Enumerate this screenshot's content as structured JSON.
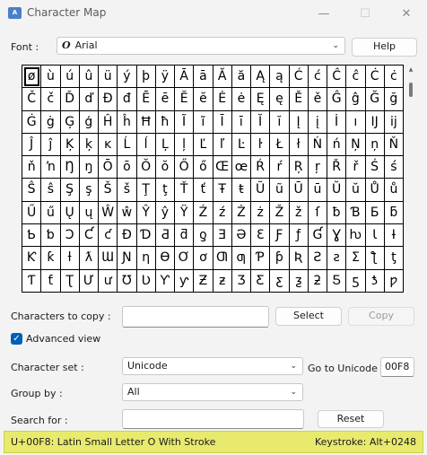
{
  "window": {
    "title": "Character Map",
    "icon_name": "character-map-app-icon",
    "controls": {
      "minimize": "—",
      "maximize": "☐",
      "close": "✕"
    }
  },
  "font": {
    "label": "Font :",
    "value": "Arial",
    "help_label": "Help"
  },
  "characters": [
    "ø",
    "ù",
    "ú",
    "û",
    "ü",
    "ý",
    "þ",
    "ÿ",
    "Ā",
    "ā",
    "Ă",
    "ă",
    "Ą",
    "ą",
    "Ć",
    "ć",
    "Ĉ",
    "ĉ",
    "Ċ",
    "ċ",
    "Č",
    "č",
    "Ď",
    "ď",
    "Đ",
    "đ",
    "Ē",
    "ē",
    "Ĕ",
    "ĕ",
    "Ė",
    "ė",
    "Ę",
    "ę",
    "Ě",
    "ě",
    "Ĝ",
    "ĝ",
    "Ğ",
    "ğ",
    "Ġ",
    "ġ",
    "Ģ",
    "ģ",
    "Ĥ",
    "ĥ",
    "Ħ",
    "ħ",
    "Ĩ",
    "ĩ",
    "Ī",
    "ī",
    "Ĭ",
    "ĭ",
    "Į",
    "į",
    "İ",
    "ı",
    "Ĳ",
    "ĳ",
    "Ĵ",
    "ĵ",
    "Ķ",
    "ķ",
    "ĸ",
    "Ĺ",
    "ĺ",
    "Ļ",
    "ļ",
    "Ľ",
    "ľ",
    "Ŀ",
    "ŀ",
    "Ł",
    "ł",
    "Ń",
    "ń",
    "Ņ",
    "ņ",
    "Ň",
    "ň",
    "ŉ",
    "Ŋ",
    "ŋ",
    "Ō",
    "ō",
    "Ŏ",
    "ŏ",
    "Ő",
    "ő",
    "Œ",
    "œ",
    "Ŕ",
    "ŕ",
    "Ŗ",
    "ŗ",
    "Ř",
    "ř",
    "Ś",
    "ś",
    "Ŝ",
    "ŝ",
    "Ş",
    "ş",
    "Š",
    "š",
    "Ţ",
    "ţ",
    "Ť",
    "ť",
    "Ŧ",
    "ŧ",
    "Ũ",
    "ũ",
    "Ū",
    "ū",
    "Ŭ",
    "ŭ",
    "Ů",
    "ů",
    "Ű",
    "ű",
    "Ų",
    "ų",
    "Ŵ",
    "ŵ",
    "Ŷ",
    "ŷ",
    "Ÿ",
    "Ź",
    "ź",
    "Ż",
    "ż",
    "Ž",
    "ž",
    "ſ",
    "ƀ",
    "Ɓ",
    "Ƃ",
    "ƃ",
    "Ƅ",
    "ƅ",
    "Ɔ",
    "Ƈ",
    "ƈ",
    "Ɖ",
    "Ɗ",
    "Ƌ",
    "ƌ",
    "ƍ",
    "Ǝ",
    "Ə",
    "Ɛ",
    "Ƒ",
    "ƒ",
    "Ɠ",
    "Ɣ",
    "ƕ",
    "Ɩ",
    "Ɨ",
    "Ƙ",
    "ƙ",
    "ƚ",
    "ƛ",
    "Ɯ",
    "Ɲ",
    "ƞ",
    "Ɵ",
    "Ơ",
    "ơ",
    "Ƣ",
    "ƣ",
    "Ƥ",
    "ƥ",
    "Ʀ",
    "Ƨ",
    "ƨ",
    "Ʃ",
    "ƪ",
    "ƫ",
    "Ƭ",
    "ƭ",
    "Ʈ",
    "Ư",
    "ư",
    "Ʊ",
    "Ʋ",
    "Ƴ",
    "ƴ",
    "Ƶ",
    "ƶ",
    "Ʒ",
    "Ƹ",
    "ƹ",
    "ƺ",
    "ƻ",
    "Ƽ",
    "ƽ",
    "ƾ",
    "ƿ"
  ],
  "selected_character": "ø",
  "copy": {
    "label": "Characters to copy :",
    "value": "",
    "select_label": "Select",
    "copy_label": "Copy"
  },
  "advanced_view": {
    "label": "Advanced view",
    "checked": true
  },
  "character_set": {
    "label": "Character set :",
    "value": "Unicode"
  },
  "goto_unicode": {
    "label": "Go to Unicode :",
    "value": "00F8"
  },
  "group_by": {
    "label": "Group by :",
    "value": "All"
  },
  "search": {
    "label": "Search for :",
    "value": "",
    "reset_label": "Reset"
  },
  "status": {
    "description": "U+00F8: Latin Small Letter O With Stroke",
    "keystroke": "Keystroke: Alt+0248",
    "highlight_color": "#e8ea6e"
  },
  "colors": {
    "accent": "#005fb8",
    "window_bg": "#f3f3f3"
  }
}
